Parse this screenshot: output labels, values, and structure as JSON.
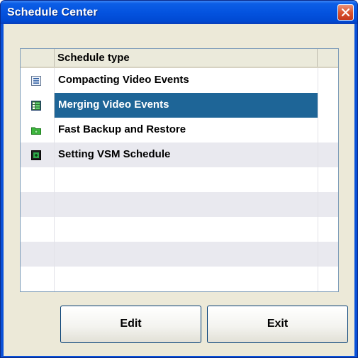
{
  "window": {
    "title": "Schedule Center"
  },
  "table": {
    "header": "Schedule type",
    "rows": [
      {
        "label": "Compacting Video Events",
        "icon": "compact-icon",
        "selected": false
      },
      {
        "label": "Merging Video Events",
        "icon": "merge-icon",
        "selected": true
      },
      {
        "label": "Fast Backup and Restore",
        "icon": "folder-icon",
        "selected": false
      },
      {
        "label": "Setting VSM Schedule",
        "icon": "vsm-icon",
        "selected": false
      },
      {
        "label": ""
      },
      {
        "label": ""
      },
      {
        "label": ""
      },
      {
        "label": ""
      },
      {
        "label": ""
      }
    ]
  },
  "buttons": {
    "edit": "Edit",
    "exit": "Exit"
  },
  "colors": {
    "titlebar": "#0453df",
    "selection": "#1e6597",
    "dialog_bg": "#ece9d8"
  }
}
